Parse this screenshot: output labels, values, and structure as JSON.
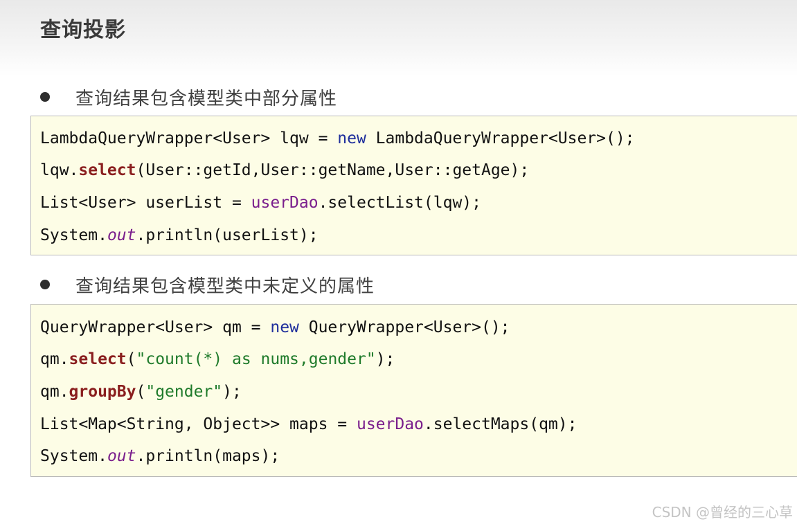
{
  "title": "查询投影",
  "sections": [
    {
      "bullet": "查询结果包含模型类中部分属性",
      "code": [
        "LambdaQueryWrapper<User> lqw = new LambdaQueryWrapper<User>();",
        "lqw.select(User::getId,User::getName,User::getAge);",
        "List<User> userList = userDao.selectList(lqw);",
        "System.out.println(userList);"
      ]
    },
    {
      "bullet": "查询结果包含模型类中未定义的属性",
      "code": [
        "QueryWrapper<User> qm = new QueryWrapper<User>();",
        "qm.select(\"count(*) as nums,gender\");",
        "qm.groupBy(\"gender\");",
        "List<Map<String, Object>> maps = userDao.selectMaps(qm);",
        "System.out.println(maps);"
      ]
    }
  ],
  "watermark": "CSDN @曾经的三心草",
  "colors": {
    "keyword": "#1f2f9c",
    "method": "#8a1e1e",
    "field": "#7a1e8c",
    "string": "#1e7a2a",
    "code_background": "#fdfde6"
  }
}
